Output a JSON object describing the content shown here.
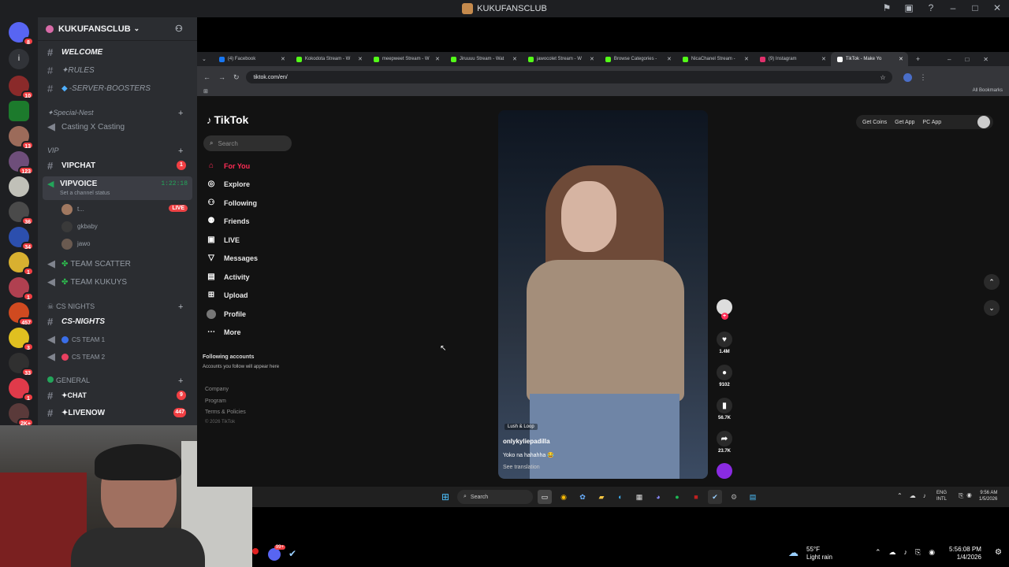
{
  "window_title": "KUKUFANSCLUB",
  "server": {
    "name": "KUKUFANSCLUB",
    "rail_badges": [
      "8",
      "10",
      "13",
      "123",
      "36",
      "34",
      "1",
      "1",
      "457",
      "3",
      "33",
      "1",
      "2K+"
    ]
  },
  "channels": {
    "welcome": "WELCOME",
    "rules": "✦RULES",
    "boosters": "-SERVER-BOOSTERS",
    "cat_special": "✦Special-Nest",
    "casting": "Casting X Casting",
    "cat_vip": "VIP",
    "vipchat": "VIPCHAT",
    "vipchat_count": "1",
    "vipvoice": "VIPVOICE",
    "vipvoice_timer": "1:22:18",
    "vipvoice_status": "Set a channel status",
    "voice_users": [
      "t...",
      "gkbaby",
      "jawo"
    ],
    "live_badge": "LIVE",
    "team_scatter": "TEAM SCATTER",
    "team_kukuys": "TEAM KUKUYS",
    "cat_csnights": "CS NIGHTS",
    "cs_nights": "CS-NIGHTS",
    "cs_team1": "CS TEAM 1",
    "cs_team2": "CS TEAM 2",
    "cat_general": "GENERAL",
    "chat": "✦CHAT",
    "chat_count": "9",
    "livenow": "✦LIVENOW",
    "livenow_count": "447"
  },
  "browser": {
    "tabs": [
      "(4) Facebook",
      "Kokodota Stream - W",
      "meepweet Stream - W",
      "Jiruuuu Stream - Wat",
      "jawocolet Stream - W",
      "Browse Categories - ",
      "NicaChanel Stream - ",
      "(9) Instagram",
      "TikTok - Make Yo"
    ],
    "url": "tiktok.com/en/",
    "bookmarks_label": "All Bookmarks"
  },
  "tiktok": {
    "logo": "TikTok",
    "search_placeholder": "Search",
    "nav": [
      "For You",
      "Explore",
      "Following",
      "Friends",
      "LIVE",
      "Messages",
      "Activity",
      "Upload",
      "Profile",
      "More"
    ],
    "following_title": "Following accounts",
    "following_sub": "Accounts you follow will appear here",
    "footer": [
      "Company",
      "Program",
      "Terms & Policies",
      "© 2026 TikTok"
    ],
    "top_buttons": [
      "Get Coins",
      "Get App",
      "PC App"
    ],
    "video": {
      "music_tag": "Lush & Loop",
      "username": "onlykyliepadilla",
      "caption": "Yoko na hahahha 😂",
      "translation": "See translation",
      "likes": "1.4M",
      "comments": "9102",
      "saves": "56.7K",
      "shares": "23.7K"
    }
  },
  "windows_taskbar": {
    "search": "Search",
    "lang1": "ENG",
    "lang2": "INTL",
    "time": "9:56 AM",
    "date": "1/5/2026"
  },
  "host_taskbar": {
    "temp": "55°F",
    "weather": "Light rain",
    "time": "5:56:08 PM",
    "date": "1/4/2026",
    "discord_badge": "99+"
  }
}
